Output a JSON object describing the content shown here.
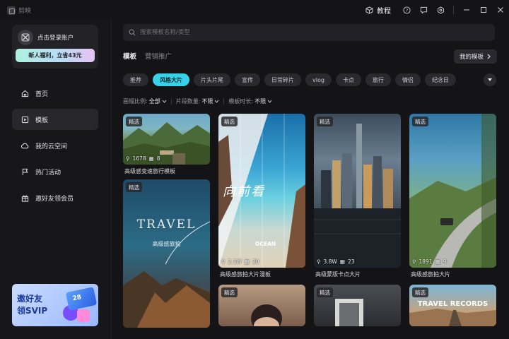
{
  "app": {
    "name": "剪映",
    "tutorial_label": "教程"
  },
  "sidebar": {
    "login_text": "点击登录账户",
    "promo": "新人福利，立省43元",
    "items": [
      {
        "label": "首页",
        "icon": "home-icon"
      },
      {
        "label": "模板",
        "icon": "template-icon"
      },
      {
        "label": "我的云空间",
        "icon": "cloud-icon"
      },
      {
        "label": "热门活动",
        "icon": "flag-icon"
      },
      {
        "label": "邀好友领会员",
        "icon": "gift-icon"
      }
    ],
    "active_index": 1,
    "invite_banner": {
      "line1": "邀好友",
      "line2": "领SVIP",
      "card_value": "28"
    }
  },
  "main": {
    "search_placeholder": "搜索模板名称/类型",
    "tabs": [
      {
        "label": "模板"
      },
      {
        "label": "营销推广"
      }
    ],
    "active_tab": 0,
    "my_templates_label": "我的模板",
    "chips": [
      "推荐",
      "风格大片",
      "片头片尾",
      "宣传",
      "日常碎片",
      "vlog",
      "卡点",
      "旅行",
      "情侣",
      "纪念日"
    ],
    "active_chip": 1,
    "filters": [
      {
        "label": "画幅比例:",
        "value": "全部"
      },
      {
        "label": "片段数量:",
        "value": "不限"
      },
      {
        "label": "模板时长:",
        "value": "不限"
      }
    ]
  },
  "cards": [
    {
      "badge": "精选",
      "uses": "1678",
      "clips": "8",
      "title": "高级感变速旅行模板"
    },
    {
      "badge": "精选",
      "uses": "",
      "clips": "",
      "title": ""
    },
    {
      "badge": "精选",
      "uses": "2.1W",
      "clips": "20",
      "title": "高级感旅拍大片漫板",
      "overlay": "向前看",
      "overlay2": "OCEAN"
    },
    {
      "badge": "精选",
      "uses": "3.8W",
      "clips": "23",
      "title": "高级蒙版卡点大片"
    },
    {
      "badge": "精选",
      "uses": "1891",
      "clips": "9",
      "title": "高级感旅拍大片"
    },
    {
      "badge": "精选",
      "uses": "",
      "clips": "",
      "title": ""
    },
    {
      "badge": "精选",
      "uses": "",
      "clips": "",
      "title": ""
    },
    {
      "badge": "精选",
      "uses": "",
      "clips": "",
      "title": "",
      "overlay": "TRAVEL RECORDS"
    },
    {
      "badge": "精选",
      "uses": "",
      "clips": "",
      "title": "",
      "overlay": "TRAVEL",
      "overlay2": "高级感旅拍"
    }
  ],
  "colors": {
    "accent": "#38d2e8",
    "background": "#141416",
    "sidebar": "#17171a"
  }
}
